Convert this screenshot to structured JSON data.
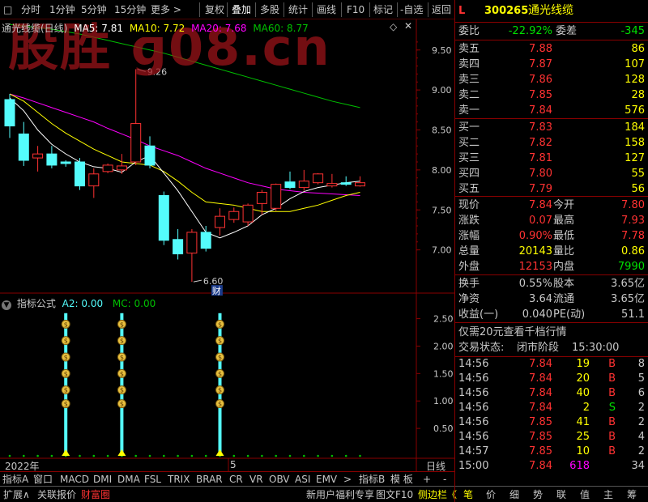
{
  "toolbar": {
    "items": [
      "分时",
      "1分钟",
      "5分钟",
      "15分钟",
      "更多 >",
      "复权",
      "叠加",
      "多股",
      "统计",
      "画线",
      "F10",
      "标记",
      "-自选",
      "返回"
    ]
  },
  "watermark": "股胜 ɡ08.cn",
  "chart": {
    "name": "通光线缆(日线)",
    "ma5": "MA5: 7.81",
    "ma10": "MA10: 7.72",
    "ma20": "MA20: 7.68",
    "ma60": "MA60: 8.77",
    "high_label": "9.26",
    "low_label": "6.60",
    "cai_label": "财",
    "y_ticks": [
      "9.50",
      "9.00",
      "8.50",
      "8.00",
      "7.50",
      "7.00"
    ],
    "colors": {
      "up": "#ff3232",
      "down": "#54fcfc",
      "ma5": "#ffffff",
      "ma10": "#ffff00",
      "ma20": "#ff00ff",
      "ma60": "#00c000"
    }
  },
  "chart_data": {
    "type": "candlestick",
    "title": "通光线缆(日线)",
    "ylim": [
      6.5,
      9.7
    ],
    "candles": [
      {
        "o": 8.88,
        "c": 8.55,
        "h": 8.95,
        "l": 8.4
      },
      {
        "o": 8.45,
        "c": 8.12,
        "h": 8.6,
        "l": 8.05
      },
      {
        "o": 8.15,
        "c": 8.2,
        "h": 8.3,
        "l": 7.98
      },
      {
        "o": 8.2,
        "c": 8.06,
        "h": 8.3,
        "l": 8.02
      },
      {
        "o": 8.1,
        "c": 8.08,
        "h": 8.12,
        "l": 8.04
      },
      {
        "o": 8.1,
        "c": 7.8,
        "h": 8.15,
        "l": 7.75
      },
      {
        "o": 7.8,
        "c": 7.95,
        "h": 8.02,
        "l": 7.65
      },
      {
        "o": 7.98,
        "c": 8.06,
        "h": 8.08,
        "l": 7.96
      },
      {
        "o": 8.0,
        "c": 8.05,
        "h": 8.2,
        "l": 7.95
      },
      {
        "o": 8.1,
        "c": 8.58,
        "h": 9.26,
        "l": 8.06
      },
      {
        "o": 8.3,
        "c": 8.06,
        "h": 8.42,
        "l": 8.02
      },
      {
        "o": 7.68,
        "c": 7.12,
        "h": 7.73,
        "l": 7.06
      },
      {
        "o": 7.13,
        "c": 6.95,
        "h": 7.26,
        "l": 6.88
      },
      {
        "o": 6.96,
        "c": 7.22,
        "h": 7.26,
        "l": 6.6
      },
      {
        "o": 7.22,
        "c": 7.02,
        "h": 7.3,
        "l": 6.98
      },
      {
        "o": 7.28,
        "c": 7.42,
        "h": 7.52,
        "l": 7.18
      },
      {
        "o": 7.38,
        "c": 7.48,
        "h": 7.53,
        "l": 7.34
      },
      {
        "o": 7.35,
        "c": 7.56,
        "h": 7.58,
        "l": 7.3
      },
      {
        "o": 7.58,
        "c": 7.72,
        "h": 7.75,
        "l": 7.44
      },
      {
        "o": 7.52,
        "c": 7.82,
        "h": 7.83,
        "l": 7.49
      },
      {
        "o": 7.85,
        "c": 7.78,
        "h": 7.98,
        "l": 7.76
      },
      {
        "o": 7.78,
        "c": 7.86,
        "h": 8.0,
        "l": 7.74
      },
      {
        "o": 7.84,
        "c": 7.95,
        "h": 7.96,
        "l": 7.82
      },
      {
        "o": 7.8,
        "c": 7.83,
        "h": 7.95,
        "l": 7.78
      },
      {
        "o": 7.84,
        "c": 7.82,
        "h": 7.92,
        "l": 7.8
      },
      {
        "o": 7.8,
        "c": 7.84,
        "h": 7.92,
        "l": 7.79
      }
    ],
    "ma5": [
      8.9,
      8.74,
      8.5,
      8.32,
      8.2,
      8.1,
      8.04,
      8.02,
      7.97,
      8.1,
      8.18,
      7.96,
      7.74,
      7.48,
      7.22,
      7.15,
      7.22,
      7.3,
      7.44,
      7.52,
      7.64,
      7.73,
      7.78,
      7.81,
      7.84,
      7.86
    ],
    "ma10": [
      8.95,
      8.86,
      8.72,
      8.58,
      8.46,
      8.36,
      8.26,
      8.18,
      8.1,
      8.08,
      8.06,
      7.98,
      7.86,
      7.72,
      7.6,
      7.58,
      7.56,
      7.52,
      7.48,
      7.48,
      7.48,
      7.52,
      7.56,
      7.62,
      7.68,
      7.72
    ],
    "ma20": [
      8.95,
      8.9,
      8.84,
      8.78,
      8.72,
      8.66,
      8.6,
      8.52,
      8.45,
      8.38,
      8.3,
      8.24,
      8.18,
      8.1,
      8.02,
      7.96,
      7.9,
      7.84,
      7.8,
      7.76,
      7.74,
      7.72,
      7.71,
      7.7,
      7.69,
      7.68
    ],
    "ma60": [
      9.82,
      9.8,
      9.78,
      9.76,
      9.73,
      9.7,
      9.66,
      9.62,
      9.58,
      9.54,
      9.5,
      9.46,
      9.41,
      9.36,
      9.31,
      9.26,
      9.21,
      9.16,
      9.11,
      9.06,
      9.01,
      8.96,
      8.91,
      8.86,
      8.82,
      8.78
    ]
  },
  "indicator": {
    "name": "指标公式",
    "a2": "A2: 0.00",
    "mc": "MC: 0.00",
    "y_ticks": [
      "2.50",
      "2.00",
      "1.50",
      "1.00",
      "0.50"
    ],
    "ylim": [
      0,
      2.7
    ],
    "signal_bars": [
      4,
      8,
      15
    ],
    "coin_values": [
      2.4,
      2.1,
      1.8,
      1.5,
      1.2,
      0.95
    ]
  },
  "time_axis": {
    "year": "2022年",
    "month": "5",
    "period": "日线"
  },
  "indicator_tabs": [
    "指标A",
    "窗口",
    "MACD",
    "DMI",
    "DMA",
    "FSL",
    "TRIX",
    "BRAR",
    "CR",
    "VR",
    "OBV",
    "ASI",
    "EMV",
    ">",
    "指标B",
    "模 板",
    "+",
    "-"
  ],
  "bottom_tabs": [
    "扩展∧",
    "关联报价",
    "财富圈",
    "新用户福利专享",
    "图文F10",
    "侧边栏《"
  ],
  "bottom_right_tabs": [
    "笔",
    "价",
    "细",
    "势",
    "联",
    "值",
    "主",
    "筹"
  ],
  "quote": {
    "code": "300265",
    "name": "通光线缆",
    "flag": "L",
    "weibi_label": "委比",
    "weibi_value": "-22.92%",
    "weicha_label": "委差",
    "weicha_value": "-345",
    "sells": [
      {
        "label": "卖五",
        "price": "7.88",
        "vol": "86"
      },
      {
        "label": "卖四",
        "price": "7.87",
        "vol": "107"
      },
      {
        "label": "卖三",
        "price": "7.86",
        "vol": "128"
      },
      {
        "label": "卖二",
        "price": "7.85",
        "vol": "28"
      },
      {
        "label": "卖一",
        "price": "7.84",
        "vol": "576"
      }
    ],
    "buys": [
      {
        "label": "买一",
        "price": "7.83",
        "vol": "184"
      },
      {
        "label": "买二",
        "price": "7.82",
        "vol": "158"
      },
      {
        "label": "买三",
        "price": "7.81",
        "vol": "127"
      },
      {
        "label": "买四",
        "price": "7.80",
        "vol": "55"
      },
      {
        "label": "买五",
        "price": "7.79",
        "vol": "56"
      }
    ],
    "stats": [
      {
        "l1": "现价",
        "v1": "7.84",
        "l2": "今开",
        "v2": "7.80",
        "c1": "#ff3232",
        "c2": "#ff3232"
      },
      {
        "l1": "涨跌",
        "v1": "0.07",
        "l2": "最高",
        "v2": "7.93",
        "c1": "#ff3232",
        "c2": "#ff3232"
      },
      {
        "l1": "涨幅",
        "v1": "0.90%",
        "l2": "最低",
        "v2": "7.78",
        "c1": "#ff3232",
        "c2": "#ff3232"
      },
      {
        "l1": "总量",
        "v1": "20143",
        "l2": "量比",
        "v2": "0.86",
        "c1": "#ffff00",
        "c2": "#ffff00"
      },
      {
        "l1": "外盘",
        "v1": "12153",
        "l2": "内盘",
        "v2": "7990",
        "c1": "#ff3232",
        "c2": "#00e000"
      }
    ],
    "stats2": [
      {
        "l1": "换手",
        "v1": "0.55%",
        "l2": "股本",
        "v2": "3.65亿"
      },
      {
        "l1": "净资",
        "v1": "3.64",
        "l2": "流通",
        "v2": "3.65亿"
      },
      {
        "l1": "收益(一)",
        "v1": "0.040",
        "l2": "PE(动)",
        "v2": "51.1"
      }
    ],
    "promo": "仅需20元查看千档行情",
    "trade_status_label": "交易状态:",
    "trade_status": "闭市阶段",
    "trade_time": "15:30:00",
    "ticks": [
      {
        "t": "14:56",
        "p": "7.84",
        "v": "19",
        "bs": "B",
        "n": "8"
      },
      {
        "t": "14:56",
        "p": "7.84",
        "v": "20",
        "bs": "B",
        "n": "5"
      },
      {
        "t": "14:56",
        "p": "7.84",
        "v": "40",
        "bs": "B",
        "n": "6"
      },
      {
        "t": "14:56",
        "p": "7.84",
        "v": "2",
        "bs": "S",
        "n": "2"
      },
      {
        "t": "14:56",
        "p": "7.85",
        "v": "41",
        "bs": "B",
        "n": "2"
      },
      {
        "t": "14:56",
        "p": "7.85",
        "v": "25",
        "bs": "B",
        "n": "4"
      },
      {
        "t": "14:57",
        "p": "7.85",
        "v": "10",
        "bs": "B",
        "n": "2"
      },
      {
        "t": "15:00",
        "p": "7.84",
        "v": "618",
        "bs": "",
        "n": "34"
      }
    ]
  }
}
